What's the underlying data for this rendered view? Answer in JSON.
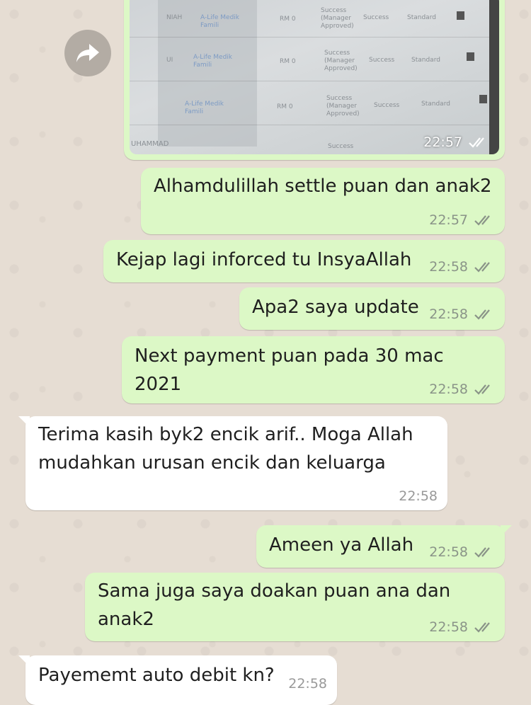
{
  "image_message": {
    "time": "22:57",
    "rows": [
      {
        "col1": "NIAH",
        "col2": "A-Life Medik Famili",
        "col3": "RM 0",
        "col4": "Success (Manager Approved)",
        "col5": "Success",
        "col6": "Standard"
      },
      {
        "col1": "UI",
        "col2": "A-Life Medik Famili",
        "col3": "RM 0",
        "col4": "Success (Manager Approved)",
        "col5": "Success",
        "col6": "Standard"
      },
      {
        "col1": "",
        "col2": "A-Life Medik Famili",
        "col3": "RM 0",
        "col4": "Success (Manager Approved)",
        "col5": "Success",
        "col6": "Standard"
      },
      {
        "col1": "UHAMMAD",
        "col2": "",
        "col3": "",
        "col4": "Success",
        "col5": "",
        "col6": ""
      }
    ]
  },
  "messages": [
    {
      "text": "Alhamdulillah settle puan dan anak2",
      "time": "22:57"
    },
    {
      "text": "Kejap lagi inforced tu InsyaAllah",
      "time": "22:58"
    },
    {
      "text": "Apa2 saya update",
      "time": "22:58"
    },
    {
      "text": "Next payment puan pada 30 mac 2021",
      "time": "22:58"
    },
    {
      "text": "Terima kasih byk2 encik arif.. Moga Allah\nmudahkan urusan encik dan keluarga",
      "time": "22:58"
    },
    {
      "text": "Ameen ya Allah",
      "time": "22:58"
    },
    {
      "text": "Sama juga saya doakan puan ana dan\nanak2",
      "time": "22:58"
    },
    {
      "text": "Payememt auto debit kn?",
      "time": "22:58"
    }
  ],
  "icons": {
    "forward": "forward-arrow-icon",
    "read_receipt": "double-check-icon"
  },
  "colors": {
    "outgoing_bubble": "#dcf8c6",
    "incoming_bubble": "#ffffff",
    "background": "#e6ddd3"
  }
}
